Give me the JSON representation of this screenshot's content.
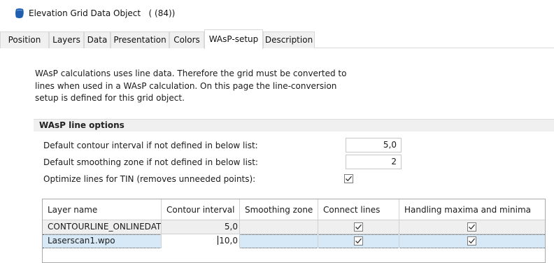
{
  "window": {
    "title": "Elevation Grid Data Object   ( (84))",
    "icon": "globe-map-icon"
  },
  "tabs": [
    {
      "label": "Position",
      "active": false
    },
    {
      "label": "Layers",
      "active": false
    },
    {
      "label": "Data",
      "active": false
    },
    {
      "label": "Presentation",
      "active": false
    },
    {
      "label": "Colors",
      "active": false
    },
    {
      "label": "WAsP-setup",
      "active": true
    },
    {
      "label": "Description",
      "active": false
    }
  ],
  "intro": {
    "line1": "WAsP calculations uses line data. Therefore the grid must be converted to",
    "line2": "lines when used in a WAsP calculation. On this page the line-conversion",
    "line3": "setup is defined for this grid object."
  },
  "options": {
    "title": "WAsP line options",
    "default_contour_label": "Default contour interval if not defined in below list:",
    "default_contour_value": "5,0",
    "default_smoothing_label": "Default smoothing zone if not defined in below list:",
    "default_smoothing_value": "2",
    "optimize_label": "Optimize lines for TIN (removes unneeded points):",
    "optimize_checked": true
  },
  "table": {
    "headers": {
      "layer_name": "Layer name",
      "contour_interval": "Contour interval",
      "smoothing_zone": "Smoothing zone",
      "connect_lines": "Connect lines",
      "handling": "Handling maxima and minima"
    },
    "rows": [
      {
        "layer_name": "CONTOURLINE_ONLINEDAT",
        "contour_interval": "5,0",
        "smoothing_zone": "",
        "connect_lines": true,
        "handling": true
      },
      {
        "layer_name": "Laserscan1.wpo",
        "contour_interval": "10,0",
        "smoothing_zone": "",
        "connect_lines": true,
        "handling": true
      }
    ]
  },
  "colors": {
    "selected_row": "#d7e8f6",
    "alt_row": "#efefef",
    "icon_blue": "#1f5fae"
  }
}
